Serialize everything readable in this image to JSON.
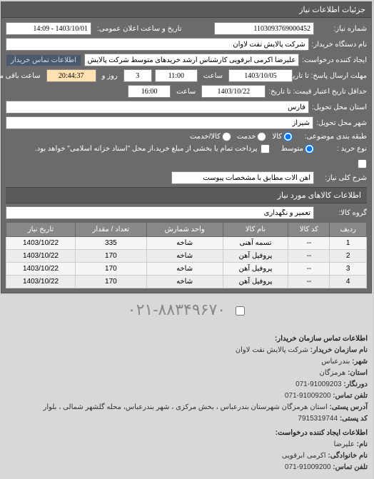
{
  "header": "جزئیات اطلاعات نیاز",
  "fields": {
    "req_no_label": "شماره نیاز:",
    "req_no": "1103093769000452",
    "announce_label": "تاریخ و ساعت اعلان عمومی:",
    "announce": "1403/10/01 - 14:09",
    "buyer_name_label": "نام دستگاه خریدار:",
    "buyer_name": "شرکت پالایش نفت لاوان",
    "creator_label": "ایجاد کننده درخواست:",
    "creator": "علیرضا اکرمی ابرقویی کارشناس ارشد خریدهای متوسط شرکت پالایش نفت لاو",
    "contact_btn": "اطلاعات تماس خریدار",
    "deadline_label": "مهلت ارسال پاسخ: تا تاریخ:",
    "deadline_date": "1403/10/05",
    "deadline_at": "ساعت",
    "deadline_time": "11:00",
    "days_sep": "روز و",
    "days": "3",
    "countdown": "20:44:37",
    "remaining": "ساعت باقی مانده",
    "validity_label": "حداقل تاریخ اعتبار قیمت: تا تاریخ:",
    "validity_date": "1403/10/22",
    "validity_at": "ساعت",
    "validity_time": "16:00",
    "province_label": "استان محل تحویل:",
    "province": "فارس",
    "city_label": "شهر محل تحویل:",
    "city": "شیراز",
    "subject_cat_label": "طبقه بندی موضوعی:",
    "radio_goods": "کالا",
    "radio_service": "خدمت",
    "radio_goods_service": "کالا/خدمت",
    "purchase_type_label": "نوع خرید :",
    "radio_medium": "متوسط",
    "purchase_note": "پرداخت تمام یا بخشی از مبلغ خرید،از محل \"اسناد خزانه اسلامی\" خواهد بود.",
    "desc_label": "شرح کلی نیاز:",
    "desc": "آهن آلات مطابق با مشخصات پیوست"
  },
  "goods_header": "اطلاعات کالاهای مورد نیاز",
  "group_label": "گروه کالا:",
  "group_value": "تعمیر و نگهداری",
  "table": {
    "headers": [
      "ردیف",
      "کد کالا",
      "نام کالا",
      "واحد شمارش",
      "تعداد / مقدار",
      "تاریخ نیاز"
    ],
    "rows": [
      [
        "1",
        "--",
        "تسمه آهنی",
        "شاخه",
        "335",
        "1403/10/22"
      ],
      [
        "2",
        "--",
        "پروفیل آهن",
        "شاخه",
        "170",
        "1403/10/22"
      ],
      [
        "3",
        "--",
        "پروفیل آهن",
        "شاخه",
        "170",
        "1403/10/22"
      ],
      [
        "4",
        "--",
        "پروفیل آهن",
        "شاخه",
        "170",
        "1403/10/22"
      ]
    ]
  },
  "watermark": "۰۲۱-۸۸۳۴۹۶۷۰",
  "footer": {
    "h1": "اطلاعات تماس سازمان خریدار:",
    "org_label": "نام سازمان خریدار:",
    "org": "شرکت پالایش نفت لاوان",
    "city_label": "شهر:",
    "city": "بندرعباس",
    "prov_label": "استان:",
    "prov": "هرمزگان",
    "fax_label": "دورنگار:",
    "fax": "91009203-071",
    "tel_label": "تلفن تماس:",
    "tel": "91009200-071",
    "addr_label": "آدرس پستی:",
    "addr": "استان هرمزگان شهرستان بندرعباس ، بخش مرکزی ، شهر بندرعباس، محله گلشهر شمالی ، بلوار",
    "post_label": "کد پستی:",
    "post": "7915319744",
    "h2": "اطلاعات ایجاد کننده درخواست:",
    "name_label": "نام:",
    "name": "علیرضا",
    "family_label": "نام خانوادگی:",
    "family": "اکرمی ابرقویی",
    "tel2_label": "تلفن تماس:",
    "tel2": "91009200-071"
  }
}
